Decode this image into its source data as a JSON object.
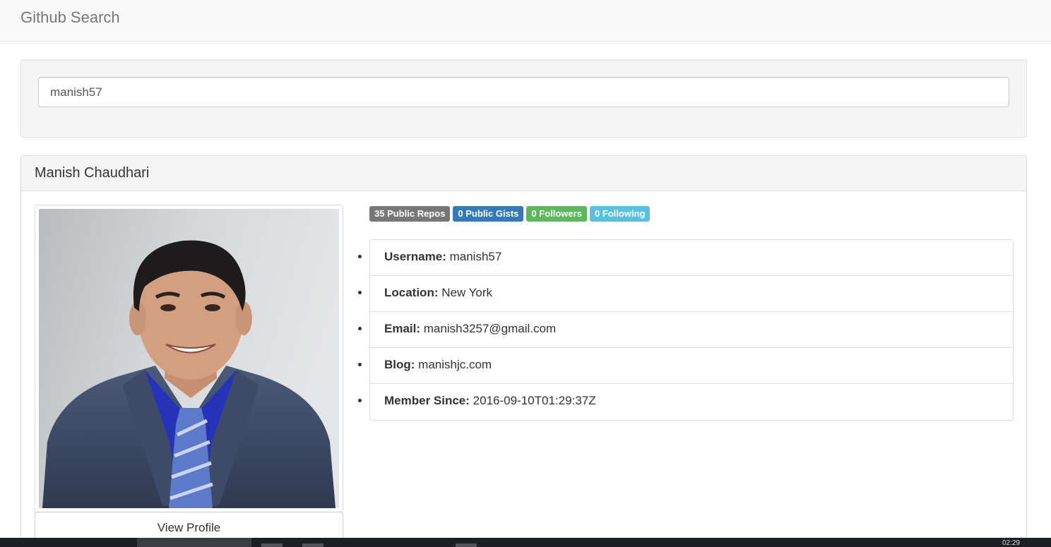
{
  "navbar": {
    "brand": "Github Search"
  },
  "search": {
    "value": "manish57"
  },
  "profile": {
    "name": "Manish Chaudhari",
    "view_profile_label": "View Profile",
    "badges": [
      {
        "label": "35 Public Repos",
        "color": "#777777"
      },
      {
        "label": "0 Public Gists",
        "color": "#337ab7"
      },
      {
        "label": "0 Followers",
        "color": "#5cb85c"
      },
      {
        "label": "0 Following",
        "color": "#5bc0de"
      }
    ],
    "details": [
      {
        "label": "Username:",
        "value": "manish57"
      },
      {
        "label": "Location:",
        "value": "New York"
      },
      {
        "label": "Email:",
        "value": "manish3257@gmail.com"
      },
      {
        "label": "Blog:",
        "value": "manishjc.com"
      },
      {
        "label": "Member Since:",
        "value": "2016-09-10T01:29:37Z"
      }
    ]
  },
  "taskbar": {
    "clock": "02:29"
  }
}
